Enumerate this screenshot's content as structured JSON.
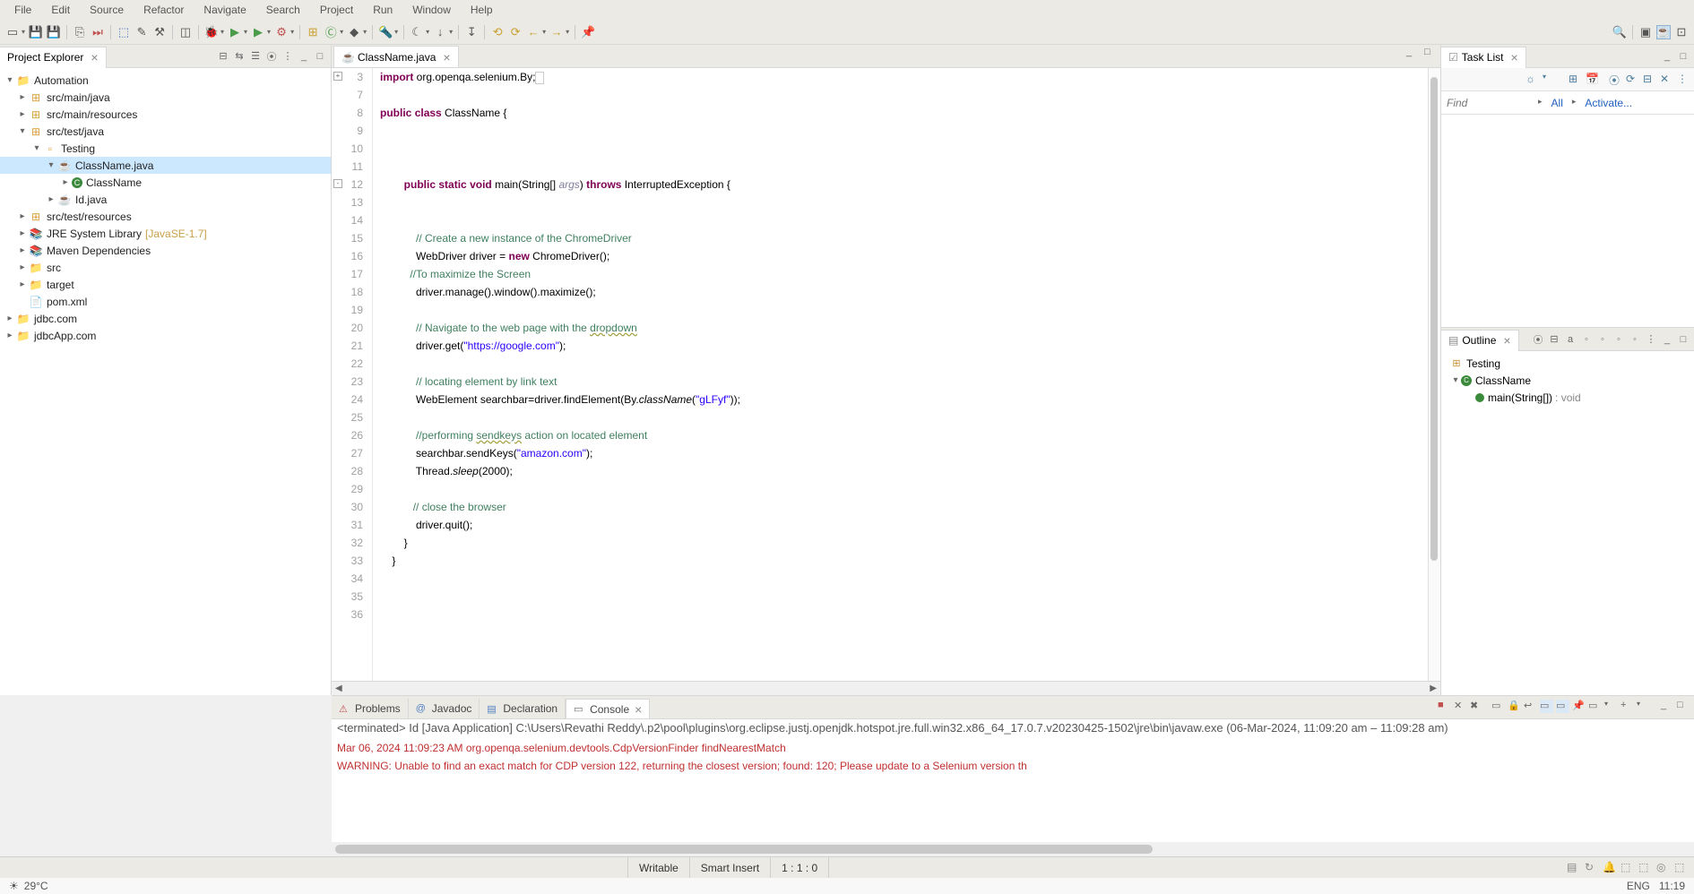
{
  "menu": [
    "File",
    "Edit",
    "Source",
    "Refactor",
    "Navigate",
    "Search",
    "Project",
    "Run",
    "Window",
    "Help"
  ],
  "explorer": {
    "title": "Project Explorer",
    "root": "Automation",
    "nodes": {
      "src_main_java": "src/main/java",
      "src_main_resources": "src/main/resources",
      "src_test_java": "src/test/java",
      "testing_pkg": "Testing",
      "classname_java": "ClassName.java",
      "classname_cls": "ClassName",
      "id_java": "Id.java",
      "src_test_resources": "src/test/resources",
      "jre_lib": "JRE System Library",
      "jre_ver": "[JavaSE-1.7]",
      "maven_deps": "Maven Dependencies",
      "src_folder": "src",
      "target_folder": "target",
      "pom": "pom.xml",
      "jdbc": "jdbc.com",
      "jdbcapp": "jdbcApp.com"
    }
  },
  "editor": {
    "tab": "ClassName.java",
    "gutter_start": 3,
    "lines": [
      {
        "n": 3,
        "html": "<span class='kw'>import</span> org.openqa.selenium.By;<span class='im-box'></span>",
        "fold": "+"
      },
      {
        "n": 7,
        "html": ""
      },
      {
        "n": 8,
        "html": "<span class='kw'>public</span> <span class='kw'>class</span> ClassName {"
      },
      {
        "n": 9,
        "html": ""
      },
      {
        "n": 10,
        "html": ""
      },
      {
        "n": 11,
        "html": ""
      },
      {
        "n": 12,
        "html": "        <span class='kw'>public</span> <span class='kw'>static</span> <span class='kw'>void</span> main(String[] <span class='fl'>args</span>) <span class='kw'>throws</span> InterruptedException {",
        "fold": "-"
      },
      {
        "n": 13,
        "html": ""
      },
      {
        "n": 14,
        "html": ""
      },
      {
        "n": 15,
        "html": "            <span class='cm'>// Create a new instance of the ChromeDriver</span>"
      },
      {
        "n": 16,
        "html": "            WebDriver driver = <span class='kw'>new</span> ChromeDriver();"
      },
      {
        "n": 17,
        "html": "          <span class='cm'>//To maximize the Screen</span>"
      },
      {
        "n": 18,
        "html": "            driver.manage().window().maximize();"
      },
      {
        "n": 19,
        "html": ""
      },
      {
        "n": 20,
        "html": "            <span class='cm'>// Navigate to the web page with the </span><span class='cm underline'>dropdown</span>"
      },
      {
        "n": 21,
        "html": "            driver.get(<span class='st'>\"https://google.com\"</span>);"
      },
      {
        "n": 22,
        "html": ""
      },
      {
        "n": 23,
        "html": "            <span class='cm'>// locating element by link text</span>"
      },
      {
        "n": 24,
        "html": "            WebElement searchbar=driver.findElement(By.<span class='ti'>className</span>(<span class='st'>\"gLFyf\"</span>));"
      },
      {
        "n": 25,
        "html": ""
      },
      {
        "n": 26,
        "html": "            <span class='cm'>//performing </span><span class='cm underline'>sendkeys</span><span class='cm'> action on located element</span>"
      },
      {
        "n": 27,
        "html": "            searchbar.sendKeys(<span class='st'>\"amazon.com\"</span>);"
      },
      {
        "n": 28,
        "html": "            Thread.<span class='ti'>sleep</span>(2000);"
      },
      {
        "n": 29,
        "html": ""
      },
      {
        "n": 30,
        "html": "           <span class='cm'>// close the browser</span>"
      },
      {
        "n": 31,
        "html": "            driver.quit();"
      },
      {
        "n": 32,
        "html": "        }"
      },
      {
        "n": 33,
        "html": "    }"
      },
      {
        "n": 34,
        "html": ""
      },
      {
        "n": 35,
        "html": ""
      },
      {
        "n": 36,
        "html": ""
      }
    ]
  },
  "tasklist": {
    "title": "Task List",
    "find_placeholder": "Find",
    "all": "All",
    "activate": "Activate..."
  },
  "outline": {
    "title": "Outline",
    "pkg": "Testing",
    "cls": "ClassName",
    "method": "main(String[])",
    "ret": " : void"
  },
  "console": {
    "tabs": {
      "problems": "Problems",
      "javadoc": "Javadoc",
      "declaration": "Declaration",
      "console": "Console"
    },
    "status": "<terminated> Id [Java Application] C:\\Users\\Revathi Reddy\\.p2\\pool\\plugins\\org.eclipse.justj.openjdk.hotspot.jre.full.win32.x86_64_17.0.7.v20230425-1502\\jre\\bin\\javaw.exe  (06-Mar-2024, 11:09:20 am – 11:09:28 am)",
    "line1": "Mar 06, 2024 11:09:23 AM org.openqa.selenium.devtools.CdpVersionFinder findNearestMatch",
    "line2": "WARNING: Unable to find an exact match for CDP version 122, returning the closest version; found: 120; Please update to a Selenium version th"
  },
  "statusbar": {
    "writable": "Writable",
    "insert": "Smart Insert",
    "pos": "1 : 1 : 0"
  },
  "taskbar": {
    "weather": "29°C",
    "lang": "ENG",
    "time": "11:19"
  }
}
